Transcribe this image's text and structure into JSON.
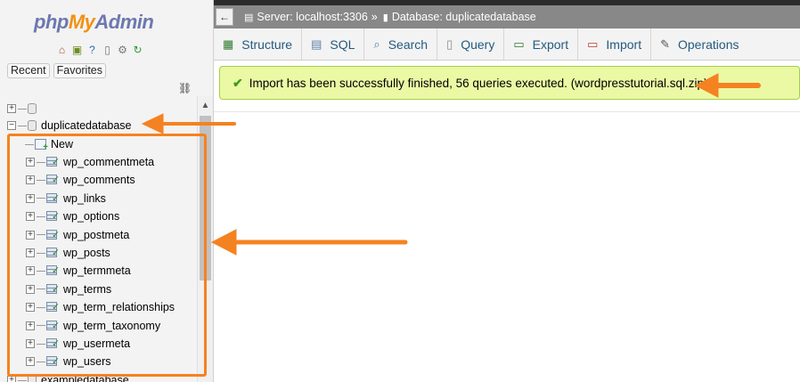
{
  "sidebar": {
    "logo": {
      "php": "php",
      "my": "My",
      "admin": "Admin"
    },
    "quick_icons": [
      "home-icon",
      "logout-icon",
      "help-icon",
      "docs-icon",
      "settings-icon",
      "reload-icon"
    ],
    "buttons": {
      "recent": "Recent",
      "favorites": "Favorites"
    },
    "tree": {
      "database": "duplicatedatabase",
      "new_label": "New",
      "tables": [
        "wp_commentmeta",
        "wp_comments",
        "wp_links",
        "wp_options",
        "wp_postmeta",
        "wp_posts",
        "wp_termmeta",
        "wp_terms",
        "wp_term_relationships",
        "wp_term_taxonomy",
        "wp_usermeta",
        "wp_users"
      ],
      "next_database": "exampledatabase"
    }
  },
  "breadcrumb": {
    "server": "Server: localhost:3306",
    "separator": "»",
    "database": "Database: duplicatedatabase"
  },
  "tabs": [
    {
      "label": "Structure",
      "icon": "structure-icon"
    },
    {
      "label": "SQL",
      "icon": "sql-icon"
    },
    {
      "label": "Search",
      "icon": "search-icon"
    },
    {
      "label": "Query",
      "icon": "query-icon"
    },
    {
      "label": "Export",
      "icon": "export-icon"
    },
    {
      "label": "Import",
      "icon": "import-icon"
    },
    {
      "label": "Operations",
      "icon": "operations-icon"
    }
  ],
  "notice": {
    "message": "Import has been successfully finished, 56 queries executed. (wordpresstutorial.sql.zip)"
  },
  "colors": {
    "annotation": "#f58220",
    "notice_bg": "#ebf8a4",
    "link": "#235a81"
  }
}
